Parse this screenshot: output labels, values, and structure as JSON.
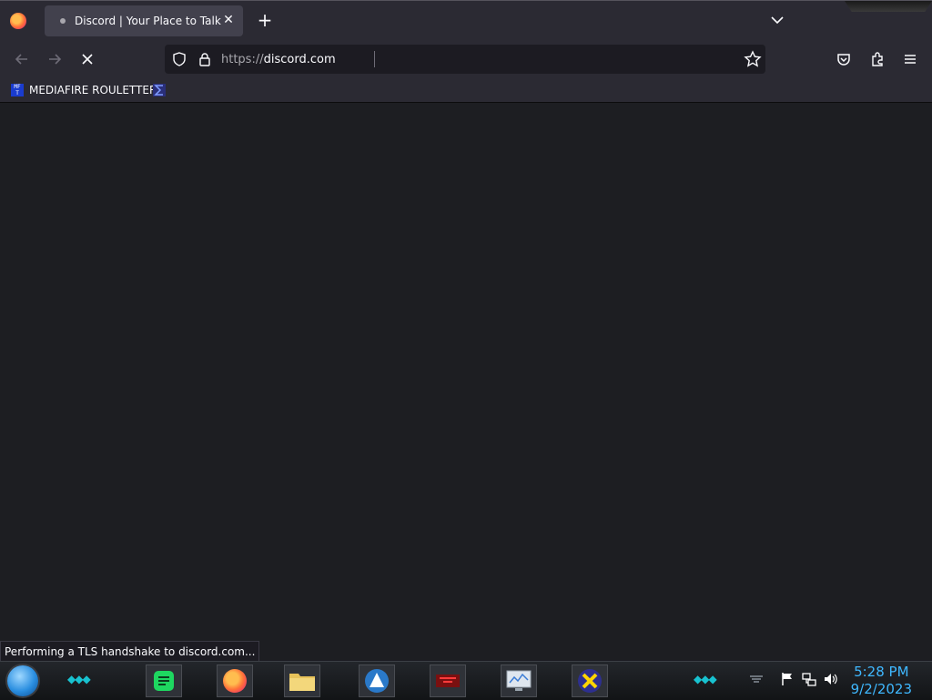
{
  "tab": {
    "title": "Discord | Your Place to Talk and",
    "close_glyph": "✕"
  },
  "newtab": {
    "glyph": "+"
  },
  "address": {
    "scheme": "https://",
    "host": "discord.com"
  },
  "bookmarks": [
    {
      "label": "MEDIAFIRE ROULETTER",
      "icon": "mediafire-icon"
    },
    {
      "icon": "bookmark-sigma-icon"
    }
  ],
  "status": {
    "text": "Performing a TLS handshake to discord.com..."
  },
  "clock": {
    "time": "5:28 PM",
    "date": "9/2/2023"
  },
  "colors": {
    "chrome": "#2b2a33",
    "content": "#1d1e22",
    "accent": "#3fb8ff"
  }
}
